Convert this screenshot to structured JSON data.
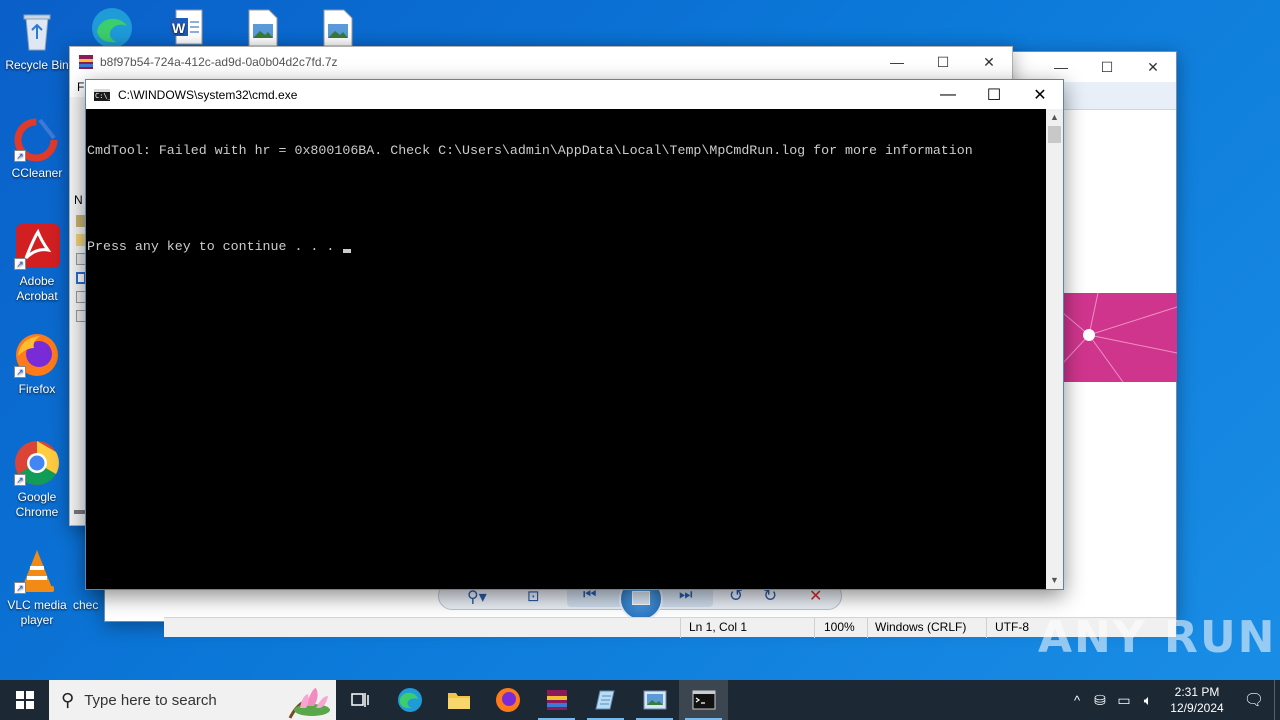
{
  "desktop": {
    "icons": [
      {
        "label": "Recycle Bin",
        "icon": "recycle-bin-icon"
      },
      {
        "label": "CCleaner",
        "icon": "ccleaner-icon"
      },
      {
        "label": "Adobe Acrobat",
        "icon": "adobe-acrobat-icon"
      },
      {
        "label": "Firefox",
        "icon": "firefox-icon"
      },
      {
        "label": "Google Chrome",
        "icon": "chrome-icon"
      },
      {
        "label": "VLC media player",
        "icon": "vlc-icon"
      },
      {
        "label": "chec",
        "icon": "file-icon"
      }
    ]
  },
  "winrar_window": {
    "title": "b8f97b54-724a-412c-ad9d-0a0b04d2c7fd.7z",
    "menu_fragment": "Fi",
    "column_fragment": "N"
  },
  "cmd_window": {
    "title": "C:\\WINDOWS\\system32\\cmd.exe",
    "icon_text": "C:\\_",
    "lines": [
      "CmdTool: Failed with hr = 0x800106BA. Check C:\\Users\\admin\\AppData\\Local\\Temp\\MpCmdRun.log for more information",
      "",
      "Press any key to continue . . . "
    ]
  },
  "notepad_status": {
    "position": "Ln 1, Col 1",
    "zoom": "100%",
    "line_ending": "Windows (CRLF)",
    "encoding": "UTF-8"
  },
  "watermark": "ANY RUN",
  "taskbar": {
    "search_placeholder": "Type here to search",
    "time": "2:31 PM",
    "date": "12/9/2024"
  },
  "colors": {
    "desktop": "#0b78d8",
    "taskbar": "#1c2834",
    "console_bg": "#000000",
    "console_text": "#cccccc",
    "photo_magenta": "#d0358e"
  }
}
